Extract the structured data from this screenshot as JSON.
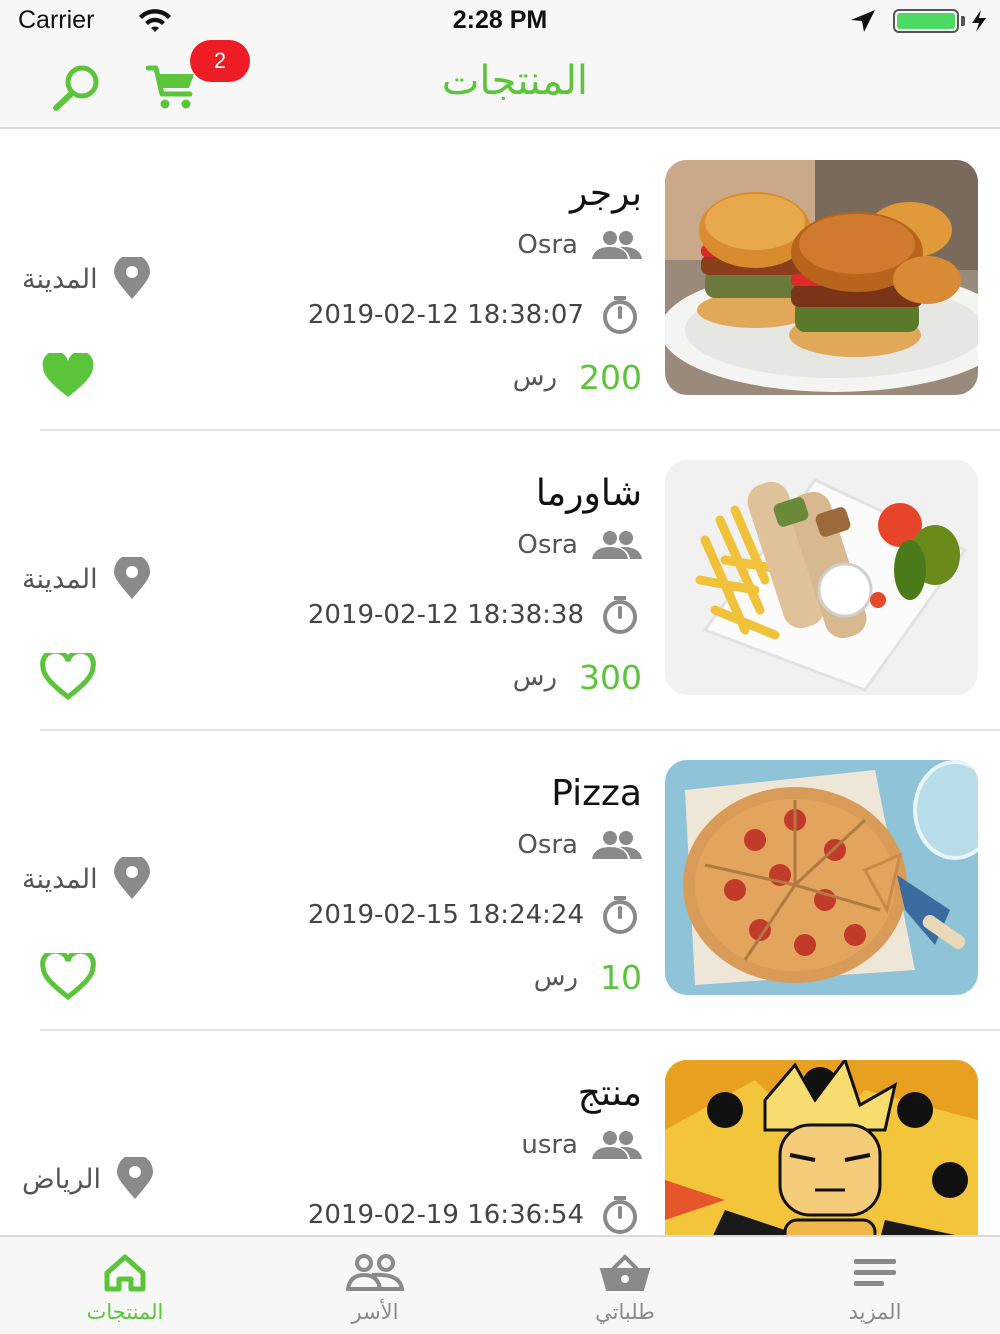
{
  "status_bar": {
    "carrier": "Carrier",
    "time": "2:28 PM",
    "battery_level": 1.0
  },
  "header": {
    "title": "المنتجات",
    "cart_count": "2",
    "accent_color": "#5cc43a",
    "badge_color": "#ee1c24"
  },
  "products": [
    {
      "name": "برجر",
      "family": "Osra",
      "date": "2019-02-12 18:38:07",
      "price": "200",
      "currency": "رس",
      "city": "المدينة",
      "favorite": true,
      "image": "burger"
    },
    {
      "name": "شاورما",
      "family": "Osra",
      "date": "2019-02-12 18:38:38",
      "price": "300",
      "currency": "رس",
      "city": "المدينة",
      "favorite": false,
      "image": "shawarma"
    },
    {
      "name": "Pizza",
      "family": "Osra",
      "date": "2019-02-15 18:24:24",
      "price": "10",
      "currency": "رس",
      "city": "المدينة",
      "favorite": false,
      "image": "pizza"
    },
    {
      "name": "منتج",
      "family": "usra",
      "date": "2019-02-19 16:36:54",
      "price": "",
      "currency": "",
      "city": "الرياض",
      "favorite": false,
      "image": "anime"
    }
  ],
  "tabs": [
    {
      "label": "المنتجات",
      "icon": "home-icon",
      "active": true
    },
    {
      "label": "الأسر",
      "icon": "people-icon",
      "active": false
    },
    {
      "label": "طلباتي",
      "icon": "basket-icon",
      "active": false
    },
    {
      "label": "المزيد",
      "icon": "menu-icon",
      "active": false
    }
  ]
}
